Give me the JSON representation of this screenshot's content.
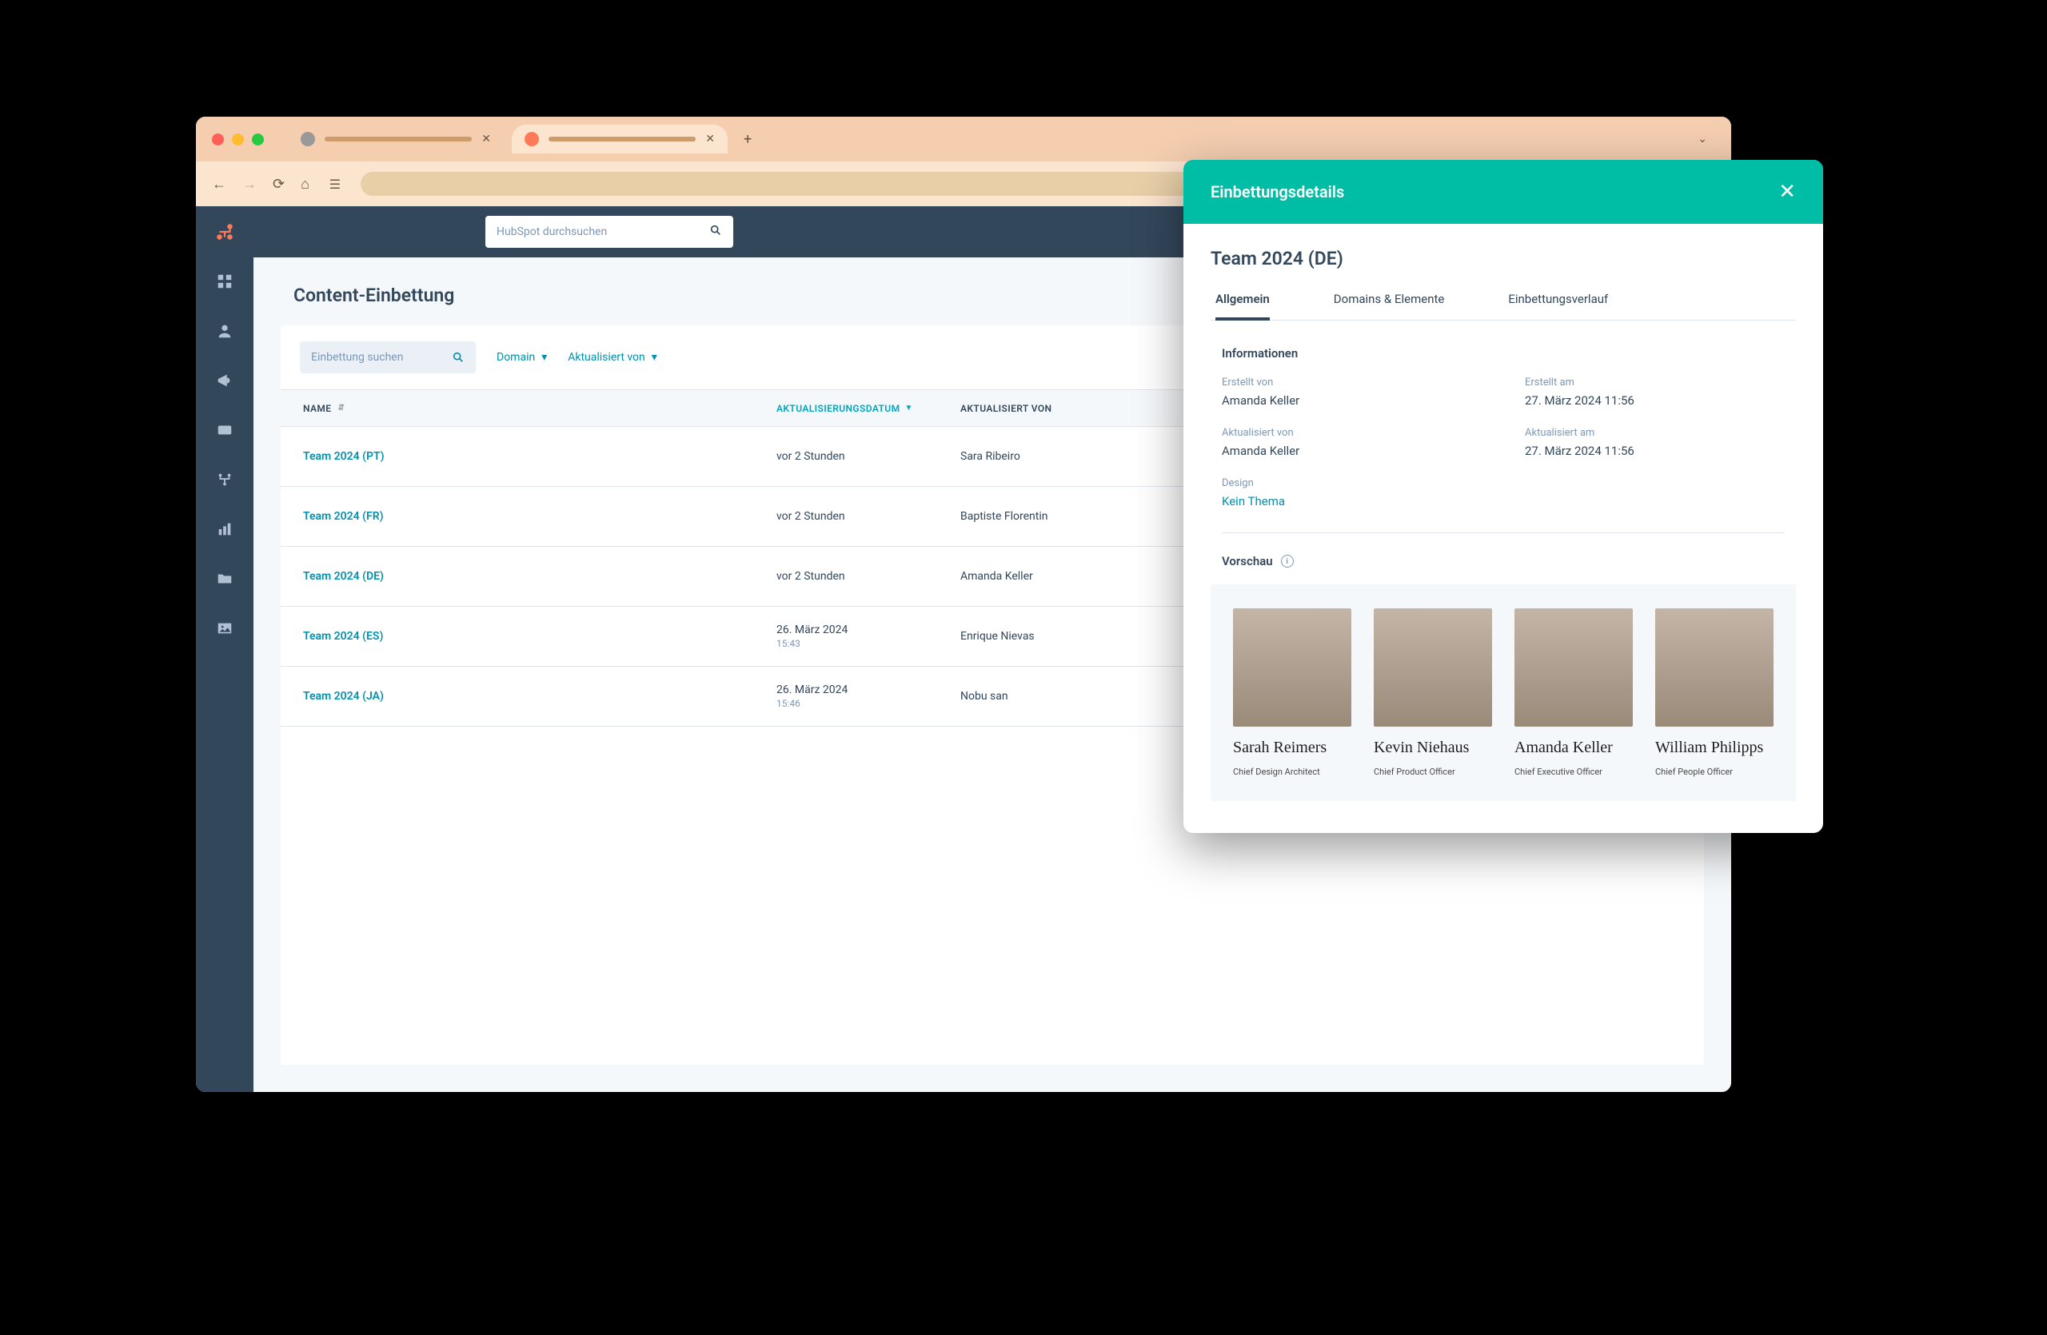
{
  "browser": {
    "tab_add": "+",
    "chev": "⌄"
  },
  "app": {
    "search_placeholder": "HubSpot durchsuchen",
    "page_title": "Content-Einbettung",
    "filter_search_placeholder": "Einbettung suchen",
    "filter_domain": "Domain",
    "filter_updated_by": "Aktualisiert von",
    "columns": {
      "name": "NAME",
      "updated": "AKTUALISIERUNGSDATUM",
      "by": "AKTUALISIERT VON"
    },
    "rows": [
      {
        "name": "Team 2024 (PT)",
        "date": "vor 2 Stunden",
        "sub": "",
        "by": "Sara Ribeiro"
      },
      {
        "name": "Team 2024 (FR)",
        "date": "vor 2 Stunden",
        "sub": "",
        "by": "Baptiste Florentin"
      },
      {
        "name": "Team 2024 (DE)",
        "date": "vor 2 Stunden",
        "sub": "",
        "by": "Amanda Keller"
      },
      {
        "name": "Team 2024 (ES)",
        "date": "26. März 2024",
        "sub": "15:43",
        "by": "Enrique Nievas"
      },
      {
        "name": "Team 2024 (JA)",
        "date": "26. März 2024",
        "sub": "15:46",
        "by": "Nobu san"
      }
    ]
  },
  "panel": {
    "header": "Einbettungsdetails",
    "title": "Team 2024 (DE)",
    "tabs": {
      "general": "Allgemein",
      "domains": "Domains & Elemente",
      "history": "Einbettungsverlauf"
    },
    "section_info": "Informationen",
    "created_by_label": "Erstellt von",
    "created_by_value": "Amanda Keller",
    "created_at_label": "Erstellt am",
    "created_at_value": "27. März 2024 11:56",
    "updated_by_label": "Aktualisiert von",
    "updated_by_value": "Amanda Keller",
    "updated_at_label": "Aktualisiert am",
    "updated_at_value": "27. März 2024 11:56",
    "design_label": "Design",
    "design_value": "Kein Thema",
    "preview_label": "Vorschau",
    "team": [
      {
        "name": "Sarah Reimers",
        "role": "Chief Design Architect"
      },
      {
        "name": "Kevin Niehaus",
        "role": "Chief Product Officer"
      },
      {
        "name": "Amanda Keller",
        "role": "Chief Executive Officer"
      },
      {
        "name": "William Philipps",
        "role": "Chief People Officer"
      }
    ]
  }
}
